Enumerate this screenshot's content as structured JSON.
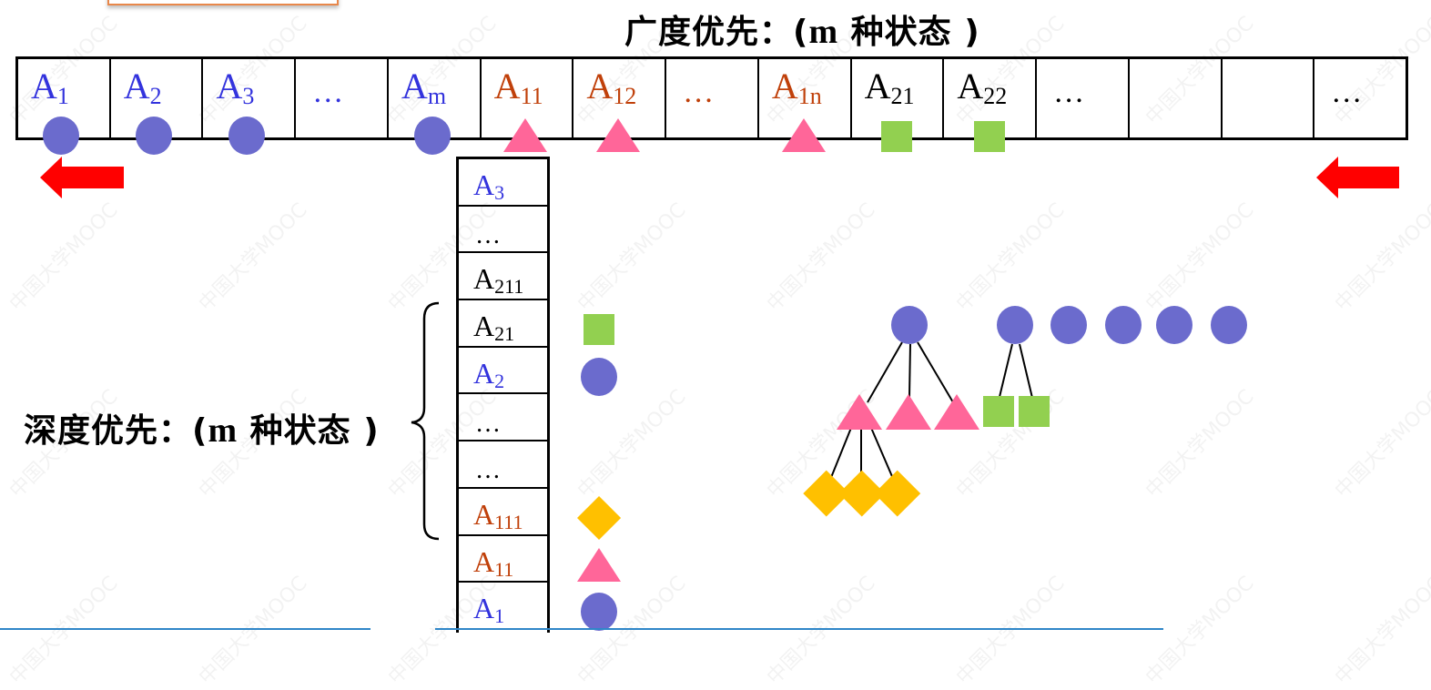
{
  "watermark": "中国大学MOOC",
  "colors": {
    "blue_text": "#3333dd",
    "orange_text": "#c0400a",
    "black_text": "#000000",
    "circle": "#6b6bcd",
    "triangle": "#ff6699",
    "square": "#92d050",
    "diamond": "#ffc000",
    "arrow": "#ff0000"
  },
  "bfs": {
    "title_prefix": "广度优先：(",
    "title_m": "m",
    "title_suffix": " 种状态 )",
    "queue": [
      {
        "base": "A",
        "sub": "1",
        "color": "blue",
        "marker": "circle"
      },
      {
        "base": "A",
        "sub": "2",
        "color": "blue",
        "marker": "circle"
      },
      {
        "base": "A",
        "sub": "3",
        "color": "blue",
        "marker": "circle"
      },
      {
        "base": "…",
        "sub": "",
        "color": "blue",
        "marker": ""
      },
      {
        "base": "A",
        "sub": "m",
        "color": "blue",
        "marker": "circle"
      },
      {
        "base": "A",
        "sub": "11",
        "color": "orange",
        "marker": "triangle"
      },
      {
        "base": "A",
        "sub": "12",
        "color": "orange",
        "marker": "triangle"
      },
      {
        "base": "…",
        "sub": "",
        "color": "orange",
        "marker": ""
      },
      {
        "base": "A",
        "sub": "1n",
        "color": "orange",
        "marker": "triangle"
      },
      {
        "base": "A",
        "sub": "21",
        "color": "black",
        "marker": "square"
      },
      {
        "base": "A",
        "sub": "22",
        "color": "black",
        "marker": "square"
      },
      {
        "base": "…",
        "sub": "",
        "color": "black",
        "marker": ""
      },
      {
        "base": "",
        "sub": "",
        "color": "black",
        "marker": ""
      },
      {
        "base": "",
        "sub": "",
        "color": "black",
        "marker": ""
      },
      {
        "base": "…",
        "sub": "",
        "color": "black",
        "marker": ""
      }
    ],
    "arrows": [
      "left-arrow-head",
      "left-arrow-tail"
    ]
  },
  "dfs": {
    "title_prefix": "深度优先：(",
    "title_m": "m",
    "title_suffix": " 种状态 )",
    "stack": [
      {
        "base": "A",
        "sub": "3",
        "color": "blue",
        "marker": ""
      },
      {
        "base": "…",
        "sub": "",
        "color": "black",
        "marker": ""
      },
      {
        "base": "A",
        "sub": "211",
        "color": "black",
        "marker": ""
      },
      {
        "base": "A",
        "sub": "21",
        "color": "black",
        "marker": "square"
      },
      {
        "base": "A",
        "sub": "2",
        "color": "blue",
        "marker": "circle"
      },
      {
        "base": "…",
        "sub": "",
        "color": "black",
        "marker": ""
      },
      {
        "base": "…",
        "sub": "",
        "color": "black",
        "marker": ""
      },
      {
        "base": "A",
        "sub": "111",
        "color": "orange",
        "marker": "diamond"
      },
      {
        "base": "A",
        "sub": "11",
        "color": "orange",
        "marker": "triangle"
      },
      {
        "base": "A",
        "sub": "1",
        "color": "blue",
        "marker": "circle"
      }
    ]
  },
  "tree": {
    "roots": [
      "circle",
      "circle",
      "circle",
      "circle",
      "circle",
      "circle"
    ],
    "children_of_root1": [
      "triangle",
      "triangle",
      "triangle"
    ],
    "children_of_root2": [
      "square",
      "square"
    ],
    "children_of_first_triangle": [
      "diamond",
      "diamond",
      "diamond"
    ]
  }
}
